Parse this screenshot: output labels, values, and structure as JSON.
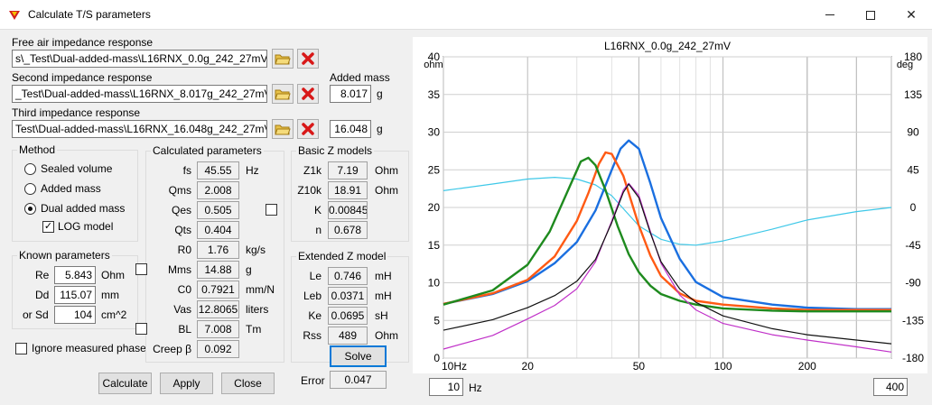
{
  "window": {
    "title": "Calculate T/S parameters"
  },
  "files": {
    "free_air_label": "Free air impedance response",
    "free_air_value": "s\\_Test\\Dual-added-mass\\L16RNX_0.0g_242_27mV.zma",
    "second_label": "Second impedance response",
    "second_value": "_Test\\Dual-added-mass\\L16RNX_8.017g_242_27mV.zma",
    "third_label": "Third impedance response",
    "third_value": "Test\\Dual-added-mass\\L16RNX_16.048g_242_27mV.zma",
    "added_mass_label": "Added mass",
    "added_mass_2": "8.017",
    "added_mass_3": "16.048",
    "unit_g": "g"
  },
  "method": {
    "title": "Method",
    "options": [
      "Sealed volume",
      "Added mass",
      "Dual added mass"
    ],
    "selected": "Dual added mass",
    "log_model": "LOG model",
    "log_checked": true
  },
  "known": {
    "title": "Known parameters",
    "re_label": "Re",
    "re": "5.843",
    "re_unit": "Ohm",
    "dd_label": "Dd",
    "dd": "115.07",
    "dd_unit": "mm",
    "sd_label": "or Sd",
    "sd": "104",
    "sd_unit": "cm^2"
  },
  "ignore_phase": "Ignore measured phase",
  "calc": {
    "title": "Calculated parameters",
    "rows": [
      {
        "label": "fs",
        "value": "45.55",
        "unit": "Hz"
      },
      {
        "label": "Qms",
        "value": "2.008",
        "unit": ""
      },
      {
        "label": "Qes",
        "value": "0.505",
        "unit": ""
      },
      {
        "label": "Qts",
        "value": "0.404",
        "unit": ""
      },
      {
        "label": "R0",
        "value": "1.76",
        "unit": "kg/s"
      },
      {
        "label": "Mms",
        "value": "14.88",
        "unit": "g"
      },
      {
        "label": "C0",
        "value": "0.7921",
        "unit": "mm/N"
      },
      {
        "label": "Vas",
        "value": "12.8065",
        "unit": "liters"
      },
      {
        "label": "BL",
        "value": "7.008",
        "unit": "Tm"
      },
      {
        "label": "Creep β",
        "value": "0.092",
        "unit": ""
      }
    ]
  },
  "basic": {
    "title": "Basic Z models",
    "rows": [
      {
        "label": "Z1k",
        "value": "7.19",
        "unit": "Ohm"
      },
      {
        "label": "Z10k",
        "value": "18.91",
        "unit": "Ohm"
      },
      {
        "label": "K",
        "value": "0.00845",
        "unit": ""
      },
      {
        "label": "n",
        "value": "0.678",
        "unit": ""
      }
    ]
  },
  "extended": {
    "title": "Extended Z model",
    "rows": [
      {
        "label": "Le",
        "value": "0.746",
        "unit": "mH"
      },
      {
        "label": "Leb",
        "value": "0.0371",
        "unit": "mH"
      },
      {
        "label": "Ke",
        "value": "0.0695",
        "unit": "sH"
      },
      {
        "label": "Rss",
        "value": "489",
        "unit": "Ohm"
      }
    ],
    "solve": "Solve",
    "error_label": "Error",
    "error": "0.047"
  },
  "buttons": {
    "calculate": "Calculate",
    "apply": "Apply",
    "close": "Close"
  },
  "range": {
    "from": "10",
    "unit": "Hz",
    "to": "400"
  },
  "chart_data": {
    "type": "line",
    "title": "L16RNX_0.0g_242_27mV",
    "x_scale": "log",
    "xlim": [
      10,
      400
    ],
    "x_ticks": [
      "10Hz",
      "20",
      "50",
      "100",
      "200"
    ],
    "ylabel_left": "ohm",
    "ylim_left": [
      0,
      40
    ],
    "y_ticks_left": [
      "40",
      "35",
      "30",
      "25",
      "20",
      "15",
      "10",
      "5",
      "0"
    ],
    "ylabel_right": "deg",
    "ylim_right": [
      -180,
      180
    ],
    "y_ticks_right": [
      "180",
      "135",
      "90",
      "45",
      "0",
      "-45",
      "-90",
      "-135",
      "-180"
    ],
    "grid": true,
    "series": [
      {
        "color": "#3ec8e8",
        "axis": "right",
        "x": [
          10,
          15,
          20,
          25,
          30,
          35,
          40,
          45,
          50,
          60,
          70,
          80,
          100,
          150,
          200,
          300,
          400
        ],
        "y": [
          20,
          28,
          34,
          36,
          34,
          27,
          14,
          -5,
          -22,
          -38,
          -44,
          -45,
          -40,
          -26,
          -15,
          -5,
          0
        ]
      },
      {
        "color": "#1a6fe0",
        "axis": "left",
        "x": [
          10,
          15,
          20,
          25,
          30,
          35,
          40,
          43,
          46,
          50,
          55,
          60,
          70,
          80,
          100,
          150,
          200,
          300,
          400
        ],
        "y": [
          7.2,
          8.5,
          10.2,
          12.6,
          15.4,
          19.6,
          25,
          27.8,
          28.9,
          27.8,
          23.2,
          18.6,
          13.2,
          10.1,
          8.1,
          7.1,
          6.7,
          6.5,
          6.5
        ]
      },
      {
        "color": "#ff5a14",
        "axis": "left",
        "x": [
          10,
          15,
          20,
          25,
          30,
          33,
          36,
          38,
          40,
          44,
          50,
          55,
          60,
          70,
          80,
          100,
          150,
          200,
          300,
          400
        ],
        "y": [
          7.2,
          8.6,
          10.4,
          13.5,
          18.2,
          21.9,
          25.8,
          27.3,
          27.1,
          24.2,
          17.6,
          13.6,
          10.9,
          8.6,
          7.6,
          7.1,
          6.6,
          6.4,
          6.4,
          6.4
        ]
      },
      {
        "color": "#1e8a1e",
        "axis": "left",
        "x": [
          10,
          15,
          20,
          24,
          28,
          31,
          33,
          35,
          38,
          42,
          46,
          50,
          55,
          60,
          70,
          80,
          100,
          150,
          200,
          300,
          400
        ],
        "y": [
          7.1,
          9,
          12.4,
          16.8,
          22.4,
          26.1,
          26.6,
          25.6,
          22.3,
          17.5,
          13.8,
          11.4,
          9.6,
          8.5,
          7.6,
          7.1,
          6.6,
          6.3,
          6.2,
          6.2,
          6.2
        ]
      },
      {
        "color": "#c030c8",
        "axis": "left",
        "x": [
          10,
          15,
          20,
          25,
          30,
          35,
          40,
          44,
          46,
          50,
          55,
          60,
          70,
          80,
          100,
          150,
          200,
          300,
          400
        ],
        "y": [
          1.2,
          3,
          5.2,
          7,
          9.2,
          12.8,
          18.2,
          22.3,
          23.2,
          21.6,
          16.8,
          12.6,
          8.4,
          6.4,
          4.6,
          3.1,
          2.4,
          1.5,
          0.8
        ]
      },
      {
        "color": "#111111",
        "axis": "left",
        "x": [
          10,
          15,
          20,
          25,
          30,
          35,
          40,
          44,
          46,
          50,
          55,
          60,
          70,
          80,
          100,
          150,
          200,
          300,
          400
        ],
        "y": [
          3.7,
          5.1,
          6.7,
          8.3,
          10.2,
          13.1,
          18,
          22,
          23.1,
          21.3,
          16.6,
          12.8,
          9.2,
          7.4,
          5.6,
          3.9,
          3.1,
          2.4,
          1.9
        ]
      }
    ]
  }
}
